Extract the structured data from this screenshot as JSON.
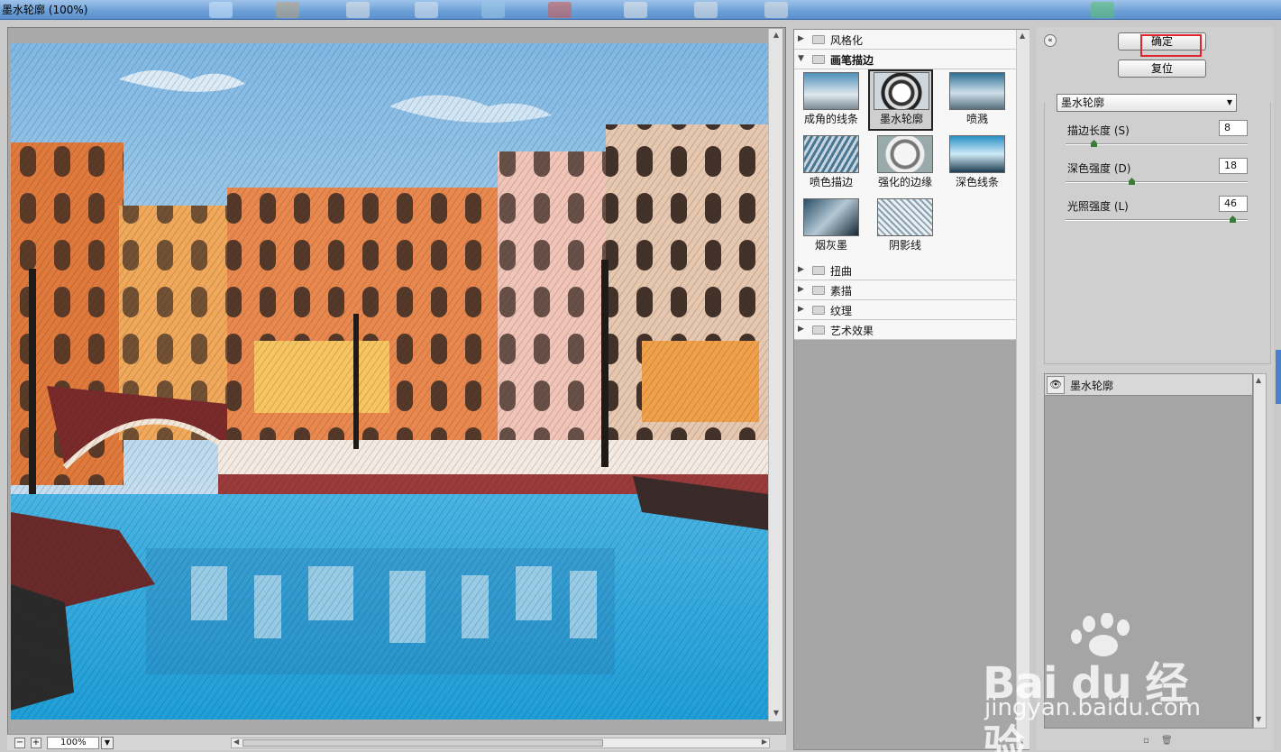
{
  "window": {
    "title": "墨水轮廓 (100%)"
  },
  "preview": {
    "zoom_value": "100%",
    "zoom_out_label": "−",
    "zoom_in_label": "+"
  },
  "filter_gallery": {
    "categories_top": [
      {
        "label": "风格化",
        "expanded": false
      },
      {
        "label": "画笔描边",
        "expanded": true
      }
    ],
    "thumbnails": [
      {
        "label": "成角的线条"
      },
      {
        "label": "墨水轮廓",
        "selected": true
      },
      {
        "label": "喷溅"
      },
      {
        "label": "喷色描边"
      },
      {
        "label": "强化的边缘"
      },
      {
        "label": "深色线条"
      },
      {
        "label": "烟灰墨"
      },
      {
        "label": "阴影线"
      }
    ],
    "categories_bottom": [
      {
        "label": "扭曲"
      },
      {
        "label": "素描"
      },
      {
        "label": "纹理"
      },
      {
        "label": "艺术效果"
      }
    ]
  },
  "controls": {
    "ok_label": "确定",
    "reset_label": "复位",
    "filter_select_value": "墨水轮廓",
    "params": [
      {
        "label": "描边长度 (S)",
        "value": "8",
        "min": 1,
        "max": 50
      },
      {
        "label": "深色强度 (D)",
        "value": "18",
        "min": 0,
        "max": 50
      },
      {
        "label": "光照强度 (L)",
        "value": "46",
        "min": 0,
        "max": 50
      }
    ]
  },
  "layers": {
    "items": [
      {
        "label": "墨水轮廓",
        "visible": true
      }
    ]
  },
  "watermark": {
    "brand": "Bai du 经验",
    "url": "jingyan.baidu.com"
  }
}
